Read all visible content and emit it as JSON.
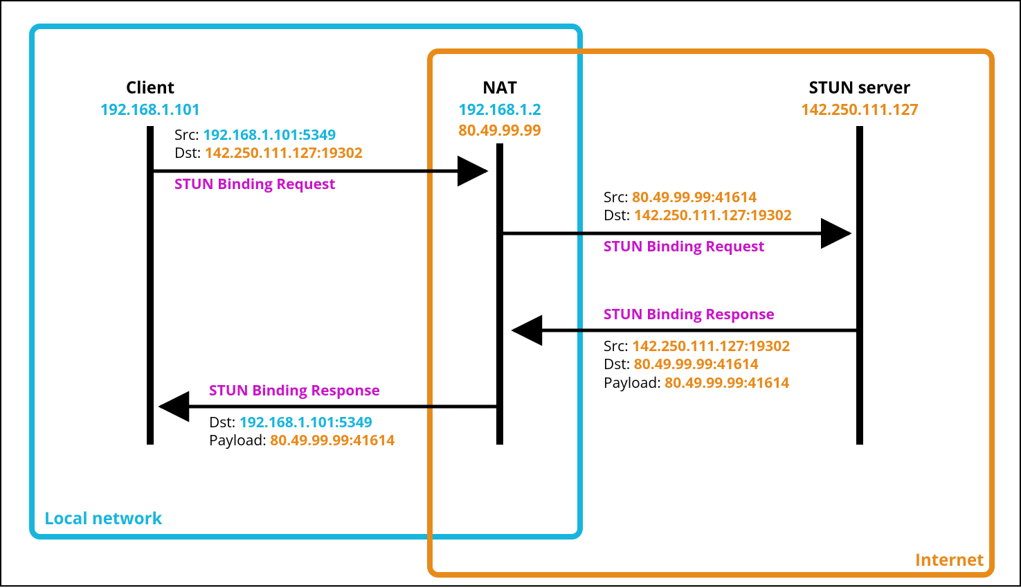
{
  "colors": {
    "blue": "#17b5dd",
    "orange": "#e88a1a",
    "magenta": "#c815c8"
  },
  "regions": {
    "local": {
      "label": "Local network"
    },
    "internet": {
      "label": "Internet"
    }
  },
  "nodes": {
    "client": {
      "title": "Client",
      "local_ip": "192.168.1.101"
    },
    "nat": {
      "title": "NAT",
      "local_ip": "192.168.1.2",
      "public_ip": "80.49.99.99"
    },
    "stun": {
      "title": "STUN server",
      "public_ip": "142.250.111.127"
    }
  },
  "labels": {
    "src": "Src:",
    "dst": "Dst:",
    "payload": "Payload:"
  },
  "messages": {
    "m1": {
      "name": "STUN Binding Request",
      "src_local": "192.168.1.101:5349",
      "dst_public": "142.250.111.127:19302"
    },
    "m2": {
      "name": "STUN Binding Request",
      "src_public": "80.49.99.99:41614",
      "dst_public": "142.250.111.127:19302"
    },
    "m3": {
      "name": "STUN Binding Response",
      "src_public": "142.250.111.127:19302",
      "dst_public": "80.49.99.99:41614",
      "payload_public": "80.49.99.99:41614"
    },
    "m4": {
      "name": "STUN Binding Response",
      "dst_local": "192.168.1.101:5349",
      "payload_public": "80.49.99.99:41614"
    }
  }
}
